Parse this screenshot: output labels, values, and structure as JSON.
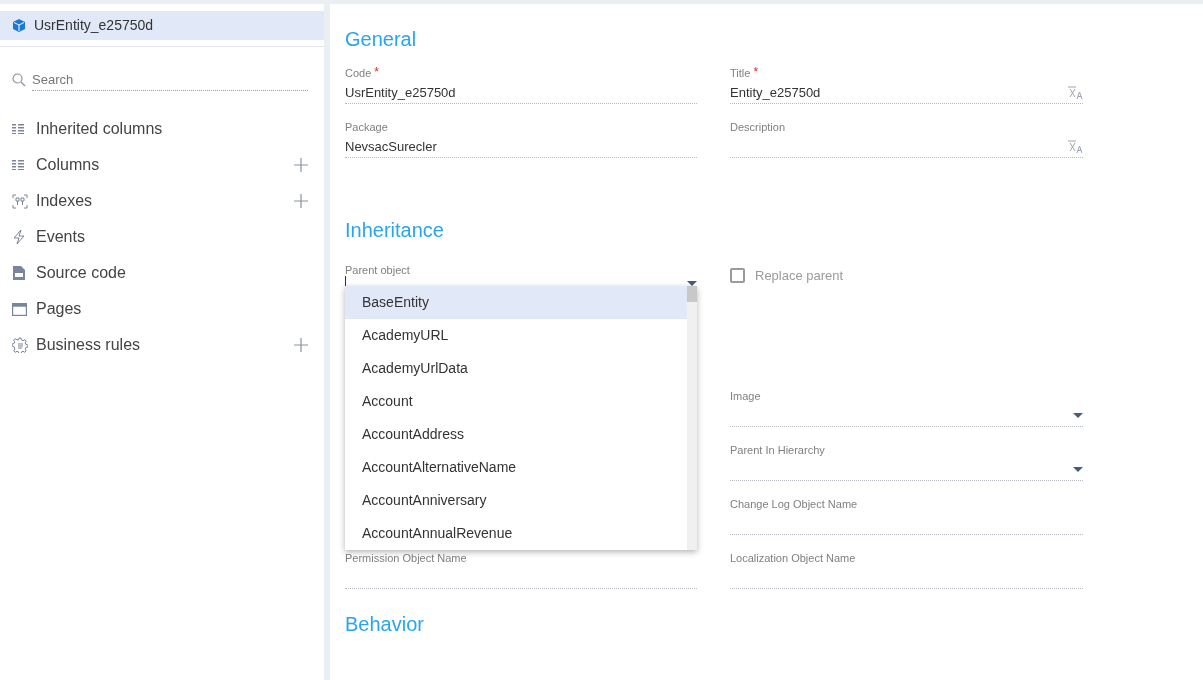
{
  "sidebar": {
    "entity": {
      "label": "UsrEntity_e25750d",
      "selected": true
    },
    "search": {
      "placeholder": "Search"
    },
    "items": [
      {
        "label": "Inherited columns",
        "kind": "list",
        "addable": false
      },
      {
        "label": "Columns",
        "kind": "list",
        "addable": true
      },
      {
        "label": "Indexes",
        "kind": "index",
        "addable": true
      },
      {
        "label": "Events",
        "kind": "event",
        "addable": false
      },
      {
        "label": "Source code",
        "kind": "code",
        "addable": false
      },
      {
        "label": "Pages",
        "kind": "page",
        "addable": false
      },
      {
        "label": "Business rules",
        "kind": "rules",
        "addable": true
      }
    ]
  },
  "general": {
    "title": "General",
    "fields": [
      {
        "label": "Code",
        "required_mark": "*",
        "value": "UsrEntity_e25750d",
        "translatable": false
      },
      {
        "label": "Title",
        "required_mark": "*",
        "value": "Entity_e25750d",
        "translatable": true
      },
      {
        "label": "Package",
        "value": "NevsacSurecler",
        "translatable": false
      },
      {
        "label": "Description",
        "translatable": true
      }
    ]
  },
  "inheritance": {
    "title": "Inheritance",
    "parent_object": {
      "label": "Parent object",
      "expanded": true,
      "options": [
        {
          "label": "BaseEntity",
          "selected": true
        },
        {
          "label": "AcademyURL",
          "selected": false
        },
        {
          "label": "AcademyUrlData",
          "selected": false
        },
        {
          "label": "Account",
          "selected": false
        },
        {
          "label": "AccountAddress",
          "selected": false
        },
        {
          "label": "AccountAlternativeName",
          "selected": false
        },
        {
          "label": "AccountAnniversary",
          "selected": false
        },
        {
          "label": "AccountAnnualRevenue",
          "selected": false
        }
      ]
    },
    "replace_parent": {
      "label": "Replace parent",
      "checked": false,
      "disabled": true
    }
  },
  "fields_right": [
    {
      "label": "Image",
      "kind": "lookup"
    },
    {
      "label": "Parent In Hierarchy",
      "kind": "lookup"
    },
    {
      "label": "Change Log Object Name",
      "kind": "text"
    },
    {
      "label": "Localization Object Name",
      "kind": "text"
    }
  ],
  "fields_left": [
    {
      "label": "Permission Object Name"
    }
  ],
  "behavior": {
    "title": "Behavior"
  }
}
